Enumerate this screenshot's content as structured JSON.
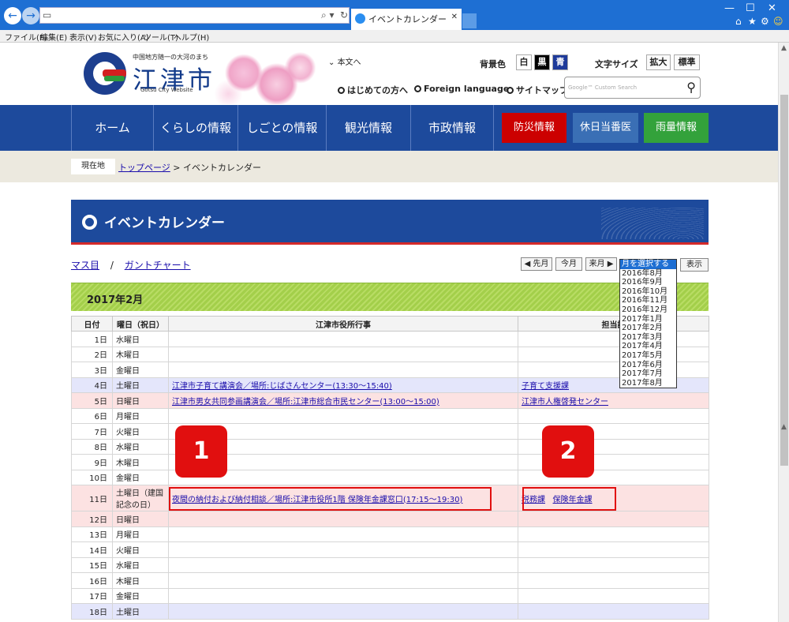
{
  "browser": {
    "tab_title": "イベントカレンダー",
    "menu": [
      "ファイル(F)",
      "編集(E)",
      "表示(V)",
      "お気に入り(A)",
      "ツール(T)",
      "ヘルプ(H)"
    ]
  },
  "header": {
    "tagline": "中国地方随一の大河のまち",
    "city_name": "江津市",
    "city_sub": "Gotsu City Website",
    "skip_link": "本文へ",
    "bgcolor_label": "背景色",
    "bg_white": "白",
    "bg_black": "黒",
    "bg_blue": "青",
    "fontsize_label": "文字サイズ",
    "font_large": "拡大",
    "font_normal": "標準",
    "link_first": "はじめての方へ",
    "link_foreign": "Foreign language",
    "link_sitemap": "サイトマップ",
    "search_placeholder": "Google™ Custom Search"
  },
  "nav": {
    "home": "ホーム",
    "life": "くらしの情報",
    "work": "しごとの情報",
    "tourism": "観光情報",
    "admin": "市政情報",
    "disaster": "防災情報",
    "holiday_doctor": "休日当番医",
    "rain": "雨量情報"
  },
  "breadcrumb": {
    "label": "現在地",
    "top": "トップページ",
    "current": "> イベントカレンダー"
  },
  "page": {
    "title": "イベントカレンダー",
    "view_grid": "マス目",
    "separator": "/",
    "view_gantt": "ガントチャート",
    "prev_month": "◀ 先月",
    "this_month": "今月",
    "next_month": "来月 ▶",
    "show_button": "表示",
    "month_heading": "2017年2月"
  },
  "month_options": [
    "月を選択する",
    "2016年8月",
    "2016年9月",
    "2016年10月",
    "2016年11月",
    "2016年12月",
    "2017年1月",
    "2017年2月",
    "2017年3月",
    "2017年4月",
    "2017年5月",
    "2017年6月",
    "2017年7月",
    "2017年8月"
  ],
  "table": {
    "headers": [
      "日付",
      "曜日（祝日）",
      "江津市役所行事",
      "担当課"
    ],
    "rows": [
      {
        "date": "1日",
        "weekday": "水曜日",
        "event": "",
        "dept": "",
        "dept2": "",
        "type": ""
      },
      {
        "date": "2日",
        "weekday": "木曜日",
        "event": "",
        "dept": "",
        "dept2": "",
        "type": ""
      },
      {
        "date": "3日",
        "weekday": "金曜日",
        "event": "",
        "dept": "",
        "dept2": "",
        "type": ""
      },
      {
        "date": "4日",
        "weekday": "土曜日",
        "event": "江津市子育て講演会／場所:じばさんセンター(13:30～15:40)",
        "dept": "子育て支援課",
        "dept2": "",
        "type": "sat"
      },
      {
        "date": "5日",
        "weekday": "日曜日",
        "event": "江津市男女共同参画講演会／場所:江津市総合市民センター(13:00～15:00)",
        "dept": "江津市人権啓発センター",
        "dept2": "",
        "type": "sun"
      },
      {
        "date": "6日",
        "weekday": "月曜日",
        "event": "",
        "dept": "",
        "dept2": "",
        "type": ""
      },
      {
        "date": "7日",
        "weekday": "火曜日",
        "event": "",
        "dept": "",
        "dept2": "",
        "type": ""
      },
      {
        "date": "8日",
        "weekday": "水曜日",
        "event": "",
        "dept": "",
        "dept2": "",
        "type": ""
      },
      {
        "date": "9日",
        "weekday": "木曜日",
        "event": "",
        "dept": "",
        "dept2": "",
        "type": ""
      },
      {
        "date": "10日",
        "weekday": "金曜日",
        "event": "",
        "dept": "",
        "dept2": "",
        "type": ""
      },
      {
        "date": "11日",
        "weekday": "土曜日（建国記念の日）",
        "event": "夜間の納付および納付相談／場所:江津市役所1階 保険年金課窓口(17:15～19:30)",
        "dept": "税務課",
        "dept2": "保険年金課",
        "type": "hol"
      },
      {
        "date": "12日",
        "weekday": "日曜日",
        "event": "",
        "dept": "",
        "dept2": "",
        "type": "sun"
      },
      {
        "date": "13日",
        "weekday": "月曜日",
        "event": "",
        "dept": "",
        "dept2": "",
        "type": ""
      },
      {
        "date": "14日",
        "weekday": "火曜日",
        "event": "",
        "dept": "",
        "dept2": "",
        "type": ""
      },
      {
        "date": "15日",
        "weekday": "水曜日",
        "event": "",
        "dept": "",
        "dept2": "",
        "type": ""
      },
      {
        "date": "16日",
        "weekday": "木曜日",
        "event": "",
        "dept": "",
        "dept2": "",
        "type": ""
      },
      {
        "date": "17日",
        "weekday": "金曜日",
        "event": "",
        "dept": "",
        "dept2": "",
        "type": ""
      },
      {
        "date": "18日",
        "weekday": "土曜日",
        "event": "",
        "dept": "",
        "dept2": "",
        "type": "sat"
      }
    ]
  },
  "markers": {
    "one": "1",
    "two": "2"
  },
  "colors": {
    "primary_blue": "#1d4a9c",
    "disaster_red": "#cc0000",
    "holiday_blue": "#3a6fb5",
    "rain_green": "#33a23b",
    "marker_red": "#e10f0f"
  }
}
